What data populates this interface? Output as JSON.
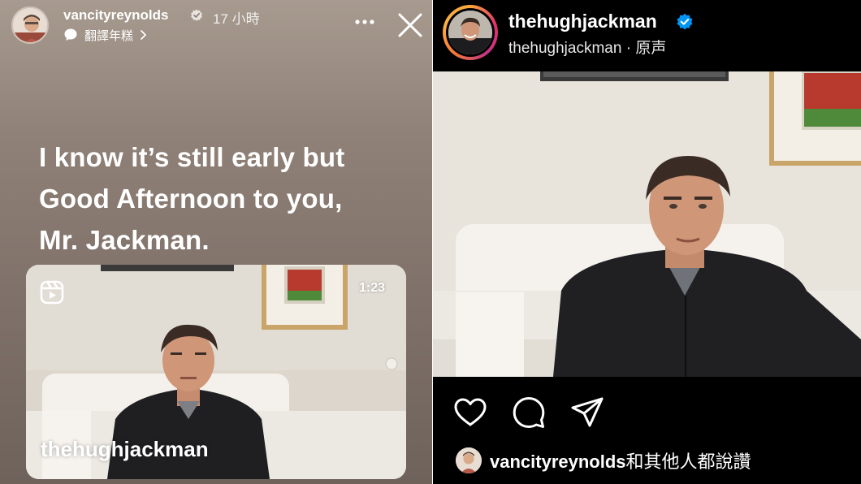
{
  "story": {
    "username": "vancityreynolds",
    "time_ago": "17 小時",
    "translate_label": "翻譯年糕",
    "caption_lines": [
      "I know it’s still early but",
      "Good Afternoon to you,",
      "Mr. Jackman."
    ],
    "reel": {
      "duration": "1:23",
      "username": "thehughjackman"
    },
    "icons": {
      "more": "more-dots-icon",
      "close": "close-icon",
      "verified": "verified-badge-icon",
      "translate": "chat-bubble-icon",
      "reel": "reels-icon"
    }
  },
  "post": {
    "username": "thehughjackman",
    "subtitle": "thehughjackman · 原声",
    "liked_by_user": "vancityreynolds",
    "liked_by_suffix": "和其他人都說讚",
    "icons": {
      "like": "heart-icon",
      "comment": "comment-icon",
      "share": "send-icon",
      "verified": "verified-badge-icon"
    }
  },
  "colors": {
    "story_bg": "#8f8177",
    "post_bg": "#000000",
    "verified_blue": "#0095f6",
    "text_white": "#ffffff"
  }
}
